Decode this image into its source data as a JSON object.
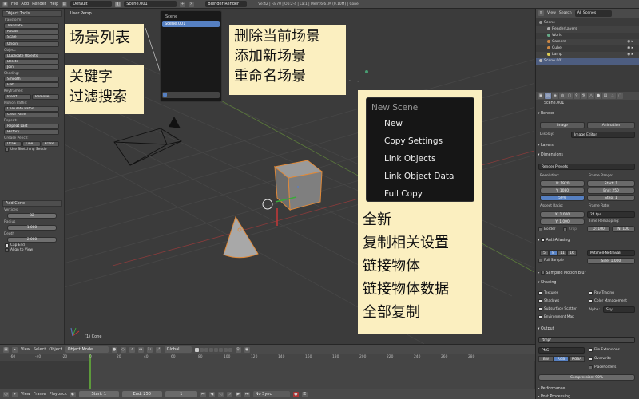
{
  "topbar": {
    "menus": [
      "File",
      "Add",
      "Render",
      "Help"
    ],
    "layout": "Default",
    "scene": "Scene.001",
    "engine": "Blender Render",
    "stats": "Ve:42 | Fa:70 | Ob:2-4 | La:1 | Mem:6.61M (0.10M) | Cone"
  },
  "shelf": {
    "tab": "Object Tools",
    "transform_label": "Transform:",
    "translate": "Translate",
    "rotate": "Rotate",
    "scale": "Scale",
    "origin": "Origin",
    "object_label": "Object:",
    "duplicate": "Duplicate Objects",
    "delete": "Delete",
    "join": "Join",
    "shading_label": "Shading:",
    "smooth": "Smooth",
    "flat": "Flat",
    "keyframes_label": "Keyframes:",
    "insert": "Insert",
    "remove": "Remove",
    "motion_label": "Motion Paths:",
    "calc_paths": "Calculate Paths",
    "clear_paths": "Clear Paths",
    "repeat_label": "Repeat:",
    "repeat_last": "Repeat Last",
    "history": "History...",
    "grease_label": "Grease Pencil:",
    "draw": "Draw",
    "line": "Line",
    "erase": "Erase",
    "sketch": "Use Sketching Sessio",
    "add_cone": "Add Cone",
    "vertices_label": "Vertices",
    "vertices": "32",
    "radius_label": "Radius",
    "radius": "1.000",
    "depth_label": "Depth",
    "depth": "2.000",
    "cap_end": "Cap End",
    "align": "Align to View"
  },
  "viewport": {
    "title": "User Persp",
    "footer": "(1) Cone"
  },
  "scene_popup": {
    "title": "Scene",
    "item": "Scene.001"
  },
  "new_scene_menu": {
    "title": "New Scene",
    "items": [
      "New",
      "Copy Settings",
      "Link Objects",
      "Link Object Data",
      "Full Copy"
    ]
  },
  "annotations": {
    "scene_list": "场景列表",
    "scene_ops": [
      "删除当前场景",
      "添加新场景",
      "重命名场景"
    ],
    "keyword": [
      "关键字",
      "过滤搜索"
    ],
    "menu_cn": [
      "全新",
      "复制相关设置",
      "链接物体",
      "链接物体数据",
      "全部复制"
    ]
  },
  "outliner": {
    "view": "View",
    "search": "Search",
    "filter": "All Scenes",
    "rows": [
      "Scene",
      "RenderLayers",
      "World",
      "Camera",
      "Cube",
      "Lamp",
      "Scene.001"
    ]
  },
  "properties": {
    "scene_name": "Scene.001",
    "render_head": "Render",
    "image": "Image",
    "animation": "Animation",
    "display_label": "Display:",
    "display": "Image Editor",
    "layers": "Layers",
    "dimensions": "Dimensions",
    "presets": "Render Presets",
    "resolution_label": "Resolution:",
    "res_x": "X: 1920",
    "res_y": "Y: 1080",
    "res_pct": "50%",
    "frame_range_label": "Frame Range:",
    "start": "Start: 1",
    "end": "End: 250",
    "step": "Step: 1",
    "aspect_label": "Aspect Ratio:",
    "asp_x": "X: 1.000",
    "asp_y": "Y: 1.000",
    "fps_label": "Frame Rate:",
    "fps": "24 fps",
    "remap_label": "Time Remapping:",
    "remap_old": "O: 100",
    "remap_new": "N: 100",
    "border": "Border",
    "crop": "Crop",
    "anti_aliasing": "Anti-Aliasing",
    "aa_values": [
      "5",
      "8",
      "11",
      "16"
    ],
    "filter": "Mitchell-Netravali",
    "full_sample": "Full Sample",
    "size": "Size: 1.000",
    "motion_blur": "Sampled Motion Blur",
    "shading": "Shading",
    "textures": "Textures",
    "ray_tracing": "Ray Tracing",
    "shadows": "Shadows",
    "color_mgmt": "Color Management",
    "sss": "Subsurface Scatter",
    "alpha_label": "Alpha:",
    "alpha": "Sky",
    "env_map": "Environment Map",
    "output": "Output",
    "output_path": "/tmp/",
    "format": "PNG",
    "file_ext": "File Extensions",
    "bw": "BW",
    "rgb": "RGB",
    "rgba": "RGBA",
    "overwrite": "Overwrite",
    "placeholders": "Placeholders",
    "compression": "Compression: 90%",
    "performance": "Performance",
    "post_processing": "Post Processing"
  },
  "vp_header": {
    "view": "View",
    "select": "Select",
    "object": "Object",
    "mode": "Object Mode",
    "orientation": "Global"
  },
  "timeline": {
    "ticks": [
      "-60",
      "-40",
      "-20",
      "0",
      "20",
      "40",
      "60",
      "80",
      "100",
      "120",
      "140",
      "160",
      "180",
      "200",
      "220",
      "240",
      "260",
      "280"
    ],
    "view": "View",
    "frame": "Frame",
    "playback": "Playback",
    "start": "Start: 1",
    "end": "End: 250",
    "current": "1",
    "sync": "No Sync"
  }
}
